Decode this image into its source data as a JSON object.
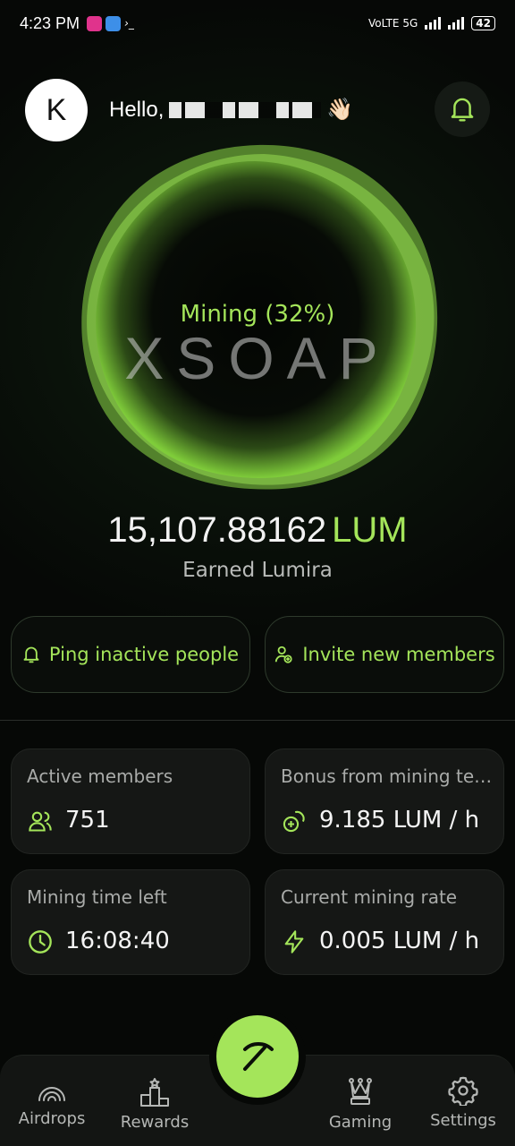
{
  "status_bar": {
    "time": "4:23 PM",
    "network": "VoLTE",
    "network_gen": "5G",
    "battery": "42"
  },
  "header": {
    "avatar_initial": "K",
    "greeting": "Hello,",
    "wave": "👋🏻"
  },
  "mining": {
    "status": "Mining (32%)",
    "brand": "XSOAP",
    "progress_percent": 32
  },
  "balance": {
    "amount": "15,107.88162",
    "unit": "LUM",
    "caption": "Earned Lumira"
  },
  "actions": {
    "ping_label": "Ping inactive people",
    "invite_label": "Invite new members"
  },
  "stats": {
    "active_members": {
      "label": "Active members",
      "value": "751"
    },
    "bonus": {
      "label": "Bonus from mining team",
      "value": "9.185 LUM / h"
    },
    "time_left": {
      "label": "Mining time left",
      "value": "16:08:40"
    },
    "rate": {
      "label": "Current mining rate",
      "value": "0.005 LUM / h"
    }
  },
  "nav": {
    "airdrops": "Airdrops",
    "rewards": "Rewards",
    "gaming": "Gaming",
    "settings": "Settings"
  },
  "colors": {
    "accent": "#a4e55a",
    "background": "#060806",
    "card": "#151715"
  }
}
